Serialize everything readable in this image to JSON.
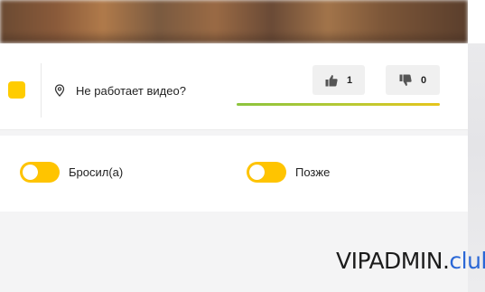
{
  "info": {
    "report_text": "Не работает видео?",
    "likes": "1",
    "dislikes": "0",
    "rating_colors": [
      "#8cc43e",
      "#e6c51c"
    ]
  },
  "toggles": [
    {
      "label": "Бросил(а)"
    },
    {
      "label": "Позже"
    }
  ],
  "watermark": {
    "main": "VIPADMIN",
    "dot": ".",
    "club": "club"
  },
  "colors": {
    "accent_yellow": "#ffc400",
    "watermark_blue": "#2a67d6"
  },
  "icons": [
    "map-pin-icon",
    "thumbs-up-icon",
    "thumbs-down-icon"
  ]
}
